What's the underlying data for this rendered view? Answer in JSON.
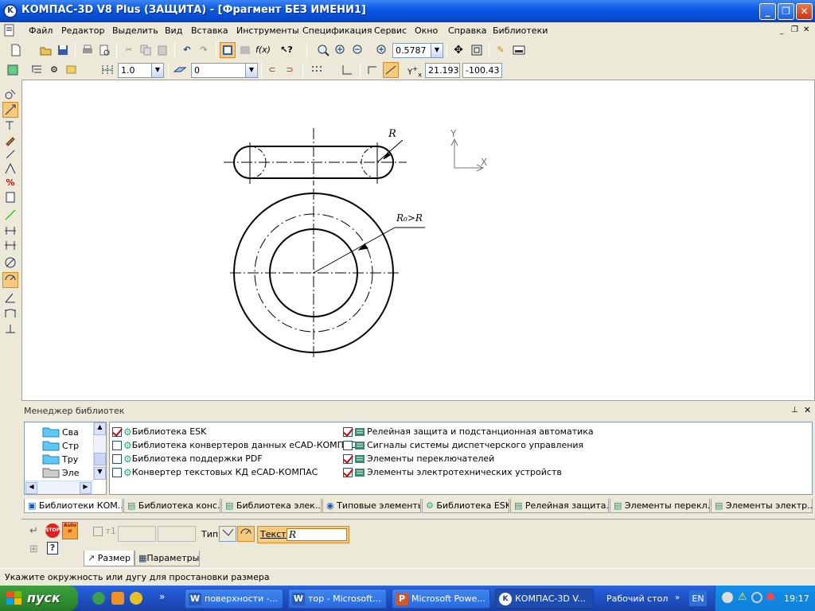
{
  "window": {
    "title": "КОМПАС-3D V8 Plus (ЗАЩИТА) - [Фрагмент БЕЗ ИМЕНИ1]"
  },
  "menu": [
    "Файл",
    "Редактор",
    "Выделить",
    "Вид",
    "Вставка",
    "Инструменты",
    "Спецификация",
    "Сервис",
    "Окно",
    "Справка",
    "Библиотеки"
  ],
  "toolbar": {
    "zoom": "0.5787",
    "step": "1.0",
    "layer": "0",
    "coord_x": "21.1938",
    "coord_y": "-100.43"
  },
  "drawing": {
    "radius_label": "R",
    "outer_radius_label": "R₀>R",
    "axis_y": "Y",
    "axis_x": "X"
  },
  "libmgr": {
    "title": "Менеджер библиотек",
    "tree": [
      "Сва",
      "Стр",
      "Тру",
      "Эле"
    ],
    "libs_left": [
      {
        "label": "Библиотека ESK",
        "checked": true
      },
      {
        "label": "Библиотека конвертеров данных eCAD-КОМПАС",
        "checked": false
      },
      {
        "label": "Библиотека поддержки PDF",
        "checked": false
      },
      {
        "label": "Конвертер текстовых КД eCAD-КОМПАС",
        "checked": false
      }
    ],
    "libs_right": [
      {
        "label": "Релейная защита и подстанционная автоматика",
        "checked": true
      },
      {
        "label": "Сигналы системы диспетчерского управления",
        "checked": false
      },
      {
        "label": "Элементы переключателей",
        "checked": true
      },
      {
        "label": "Элементы электротехнических устройств",
        "checked": true
      }
    ],
    "tabs": [
      "Библиотеки КОМ...",
      "Библиотека конс...",
      "Библиотека элек...",
      "Типовые элементы",
      "Библиотека ESK",
      "Релейная защита...",
      "Элементы перекл...",
      "Элементы электр..."
    ]
  },
  "props": {
    "type_label": "Тип",
    "text_label": "Текст",
    "text_value": "R",
    "tab_size": "Размер",
    "tab_params": "Параметры",
    "auto": "Auto",
    "stop": "STOP"
  },
  "status": "Укажите окружность или дугу для простановки размера",
  "taskbar": {
    "start": "пуск",
    "tasks": [
      "поверхности -...",
      "тор - Microsoft...",
      "Microsoft Powe...",
      "КОМПАС-3D V..."
    ],
    "desktop": "Рабочий стол",
    "lang": "EN",
    "time": "19:17"
  },
  "colors": {
    "title_bar": "#0a5ae8",
    "taskbar": "#245edb",
    "start": "#2f8f2f",
    "check": "#dd0000"
  }
}
